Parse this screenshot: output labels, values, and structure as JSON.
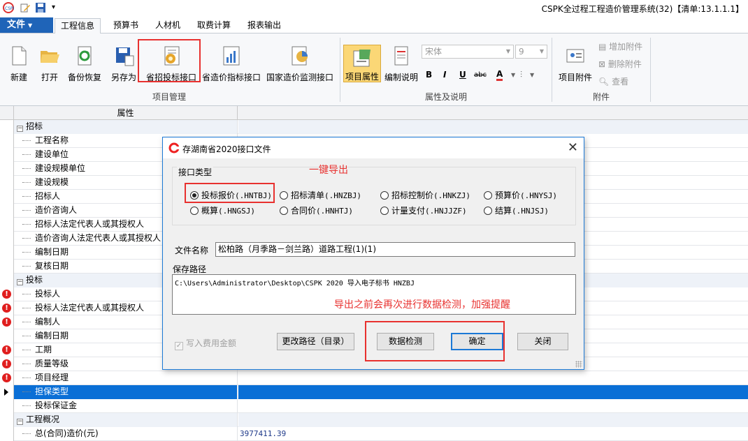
{
  "app": {
    "title": "CSPK全过程工程造价管理系统(32)【清单:13.1.1.1】"
  },
  "file_menu": {
    "label": "文件"
  },
  "tabs": [
    {
      "label": "工程信息",
      "active": true
    },
    {
      "label": "预算书"
    },
    {
      "label": "人材机"
    },
    {
      "label": "取费计算"
    },
    {
      "label": "报表输出"
    }
  ],
  "ribbon": {
    "project_group": {
      "label": "项目管理",
      "buttons": [
        "新建",
        "打开",
        "备份恢复",
        "另存为",
        "省招投标接口",
        "省造价指标接口",
        "国家造价监测接口"
      ]
    },
    "props_group": {
      "label": "属性及说明",
      "buttons": [
        "项目属性",
        "编制说明"
      ],
      "font_name": "宋体",
      "font_size": "9",
      "format_buttons": [
        "B",
        "I",
        "U",
        "abc",
        "A"
      ]
    },
    "attach_group": {
      "label": "附件",
      "main_button": "项目附件",
      "small_buttons": [
        "增加附件",
        "删除附件",
        "查看"
      ]
    }
  },
  "grid": {
    "header": "属性",
    "rows": [
      {
        "name": "招标",
        "kind": "group",
        "warn": false,
        "value": ""
      },
      {
        "name": "工程名称",
        "kind": "item",
        "warn": false,
        "value": ""
      },
      {
        "name": "建设单位",
        "kind": "item",
        "warn": false,
        "value": ""
      },
      {
        "name": "建设规模单位",
        "kind": "item",
        "warn": false,
        "value": ""
      },
      {
        "name": "建设规模",
        "kind": "item",
        "warn": false,
        "value": ""
      },
      {
        "name": "招标人",
        "kind": "item",
        "warn": false,
        "value": ""
      },
      {
        "name": "造价咨询人",
        "kind": "item",
        "warn": false,
        "value": ""
      },
      {
        "name": "招标人法定代表人或其授权人",
        "kind": "item",
        "warn": false,
        "value": ""
      },
      {
        "name": "造价咨询人法定代表人或其授权人",
        "kind": "item",
        "warn": false,
        "value": ""
      },
      {
        "name": "编制日期",
        "kind": "item",
        "warn": false,
        "value": ""
      },
      {
        "name": "复核日期",
        "kind": "item",
        "warn": false,
        "value": ""
      },
      {
        "name": "投标",
        "kind": "group",
        "warn": false,
        "value": ""
      },
      {
        "name": "投标人",
        "kind": "item",
        "warn": true,
        "value": ""
      },
      {
        "name": "投标人法定代表人或其授权人",
        "kind": "item",
        "warn": true,
        "value": ""
      },
      {
        "name": "编制人",
        "kind": "item",
        "warn": true,
        "value": ""
      },
      {
        "name": "编制日期",
        "kind": "item",
        "warn": false,
        "value": ""
      },
      {
        "name": "工期",
        "kind": "item",
        "warn": true,
        "value": ""
      },
      {
        "name": "质量等级",
        "kind": "item",
        "warn": true,
        "value": ""
      },
      {
        "name": "项目经理",
        "kind": "item",
        "warn": true,
        "value": ""
      },
      {
        "name": "担保类型",
        "kind": "item",
        "warn": false,
        "selected": true,
        "value": ""
      },
      {
        "name": "投标保证金",
        "kind": "item",
        "warn": false,
        "value": ""
      },
      {
        "name": "工程概况",
        "kind": "group",
        "warn": false,
        "value": ""
      },
      {
        "name": "总(合同)造价(元)",
        "kind": "item",
        "warn": false,
        "value": "3977411.39"
      }
    ]
  },
  "dialog": {
    "title": "存湖南省2020接口文件",
    "interface_legend": "接口类型",
    "radios": [
      {
        "label": "投标报价",
        "code": "(.HNTBJ)",
        "checked": true
      },
      {
        "label": "招标清单",
        "code": "(.HNZBJ)",
        "checked": false
      },
      {
        "label": "招标控制价",
        "code": "(.HNKZJ)",
        "checked": false
      },
      {
        "label": "预算价",
        "code": "(.HNYSJ)",
        "checked": false
      },
      {
        "label": "概算",
        "code": "(.HNGSJ)",
        "checked": false
      },
      {
        "label": "合同价",
        "code": "(.HNHTJ)",
        "checked": false
      },
      {
        "label": "计量支付",
        "code": "(.HNJJZF)",
        "checked": false
      },
      {
        "label": "结算",
        "code": "(.HNJSJ)",
        "checked": false
      }
    ],
    "file_name_label": "文件名称",
    "file_name_value": "松柏路（月季路－剑兰路）道路工程(1)(1)",
    "save_path_label": "保存路径",
    "save_path_value": "C:\\Users\\Administrator\\Desktop\\CSPK 2020 导入电子标书 HNZBJ",
    "write_fee_label": "写入费用金额",
    "change_path_button": "更改路径（目录）",
    "data_check_button": "数据检测",
    "ok_button": "确定",
    "close_button": "关闭"
  },
  "annotations": {
    "one_click_export": "一键导出",
    "check_note": "导出之前会再次进行数据检测，加强提醒"
  },
  "colors": {
    "accent": "#1f64b8",
    "selection": "#0a6fd6",
    "annotation": "#e8312f",
    "warning": "#e01e1e"
  }
}
